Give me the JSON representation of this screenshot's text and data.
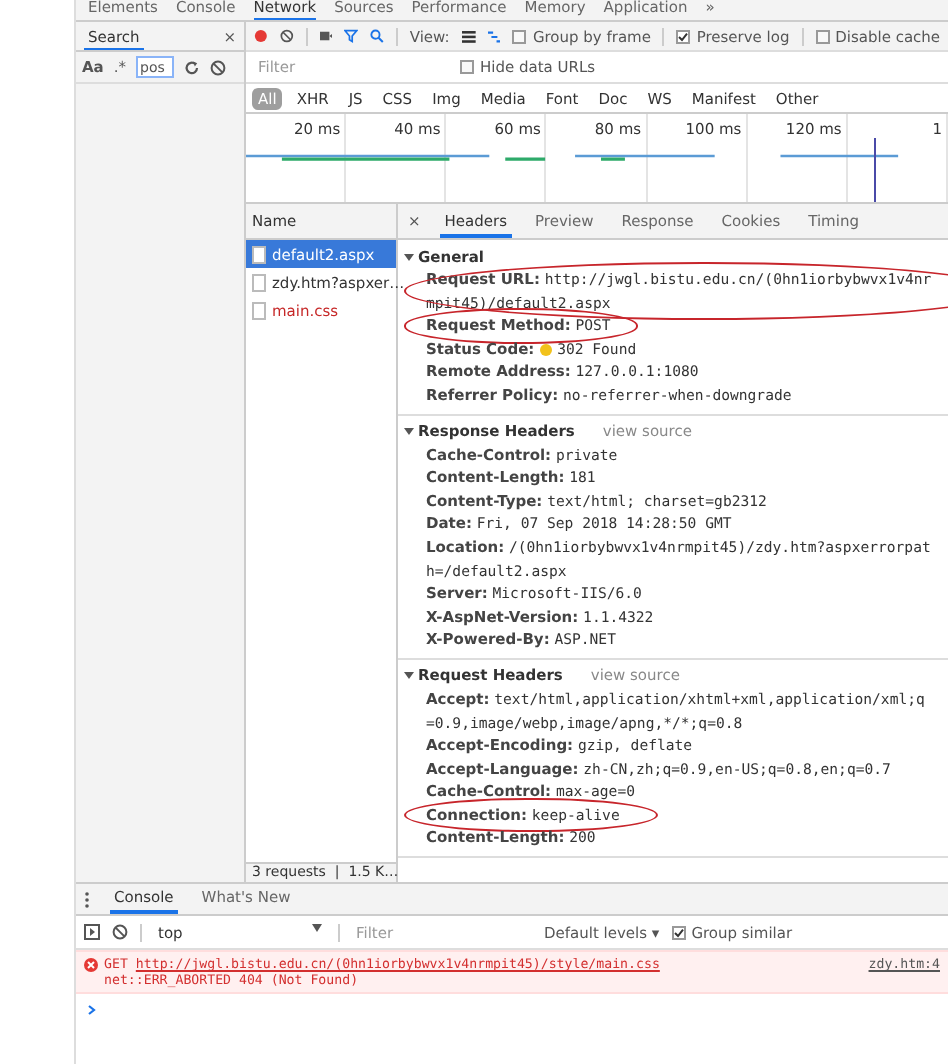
{
  "top_tabs": [
    {
      "label": "Elements",
      "selected": false
    },
    {
      "label": "Console",
      "selected": false
    },
    {
      "label": "Network",
      "selected": true
    },
    {
      "label": "Sources",
      "selected": false
    },
    {
      "label": "Performance",
      "selected": false
    },
    {
      "label": "Memory",
      "selected": false
    },
    {
      "label": "Application",
      "selected": false
    },
    {
      "label": "»",
      "selected": false
    }
  ],
  "search_panel": {
    "title": "Search",
    "close": "×",
    "case_option": "Aa",
    "regex_option": ".*",
    "query": "pos"
  },
  "network_toolbar": {
    "recording": true,
    "view_label": "View:",
    "checkboxes": [
      {
        "label": "Group by frame",
        "checked": false
      },
      {
        "label": "Preserve log",
        "checked": true
      },
      {
        "label": "Disable cache",
        "checked": false
      }
    ]
  },
  "filter": {
    "placeholder": "Filter",
    "hide_data_urls": {
      "label": "Hide data URLs",
      "checked": false
    }
  },
  "type_filters": [
    {
      "label": "All",
      "selected": true
    },
    {
      "label": "XHR",
      "selected": false
    },
    {
      "label": "JS",
      "selected": false
    },
    {
      "label": "CSS",
      "selected": false
    },
    {
      "label": "Img",
      "selected": false
    },
    {
      "label": "Media",
      "selected": false
    },
    {
      "label": "Font",
      "selected": false
    },
    {
      "label": "Doc",
      "selected": false
    },
    {
      "label": "WS",
      "selected": false
    },
    {
      "label": "Manifest",
      "selected": false
    },
    {
      "label": "Other",
      "selected": false
    }
  ],
  "timeline": {
    "ticks": [
      "20 ms",
      "40 ms",
      "60 ms",
      "80 ms",
      "100 ms",
      "120 ms",
      "1"
    ]
  },
  "requests": {
    "header": "Name",
    "items": [
      {
        "name": "default2.aspx",
        "selected": true,
        "failed": false
      },
      {
        "name": "zdy.htm?aspxer…",
        "selected": false,
        "failed": false
      },
      {
        "name": "main.css",
        "selected": false,
        "failed": true
      }
    ],
    "status": "3 requests  |  1.5 K…"
  },
  "detail_tabs": {
    "close": "×",
    "tabs": [
      {
        "label": "Headers",
        "selected": true
      },
      {
        "label": "Preview",
        "selected": false
      },
      {
        "label": "Response",
        "selected": false
      },
      {
        "label": "Cookies",
        "selected": false
      },
      {
        "label": "Timing",
        "selected": false
      }
    ]
  },
  "sections": [
    {
      "title": "General",
      "expanded": true,
      "rows": [
        {
          "kind": "plain",
          "name": "Request URL:",
          "value": "http://jwgl.bistu.edu.cn/(0hn1iorbybwvx1v4nrmpit45)/default2.aspx",
          "circled": true
        },
        {
          "kind": "plain",
          "name": "Request Method:",
          "value": "POST",
          "circled": true
        },
        {
          "kind": "status",
          "name": "Status Code:",
          "value": "302  Found",
          "color": "#f2c21b",
          "circled": false
        },
        {
          "kind": "plain",
          "name": "Remote Address:",
          "value": "127.0.0.1:1080",
          "circled": false
        },
        {
          "kind": "plain",
          "name": "Referrer Policy:",
          "value": "no-referrer-when-downgrade",
          "circled": false
        }
      ]
    },
    {
      "title": "Response Headers",
      "link": "view source",
      "expanded": true,
      "rows": [
        {
          "kind": "plain",
          "name": "Cache-Control:",
          "value": "private",
          "circled": false
        },
        {
          "kind": "plain",
          "name": "Content-Length:",
          "value": "181",
          "circled": false
        },
        {
          "kind": "plain",
          "name": "Content-Type:",
          "value": "text/html; charset=gb2312",
          "circled": false
        },
        {
          "kind": "plain",
          "name": "Date:",
          "value": "Fri, 07 Sep 2018 14:28:50 GMT",
          "circled": false
        },
        {
          "kind": "plain",
          "name": "Location:",
          "value": "/(0hn1iorbybwvx1v4nrmpit45)/zdy.htm?aspxerrorpath=/default2.aspx",
          "circled": false
        },
        {
          "kind": "plain",
          "name": "Server:",
          "value": "Microsoft-IIS/6.0",
          "circled": false
        },
        {
          "kind": "plain",
          "name": "X-AspNet-Version:",
          "value": "1.1.4322",
          "circled": false
        },
        {
          "kind": "plain",
          "name": "X-Powered-By:",
          "value": "ASP.NET",
          "circled": false
        }
      ]
    },
    {
      "title": "Request Headers",
      "link": "view source",
      "expanded": true,
      "rows": [
        {
          "kind": "plain",
          "name": "Accept:",
          "value": "text/html,application/xhtml+xml,application/xml;q=0.9,image/webp,image/apng,*/*;q=0.8",
          "circled": false
        },
        {
          "kind": "plain",
          "name": "Accept-Encoding:",
          "value": "gzip, deflate",
          "circled": false
        },
        {
          "kind": "plain",
          "name": "Accept-Language:",
          "value": "zh-CN,zh;q=0.9,en-US;q=0.8,en;q=0.7",
          "circled": false
        },
        {
          "kind": "plain",
          "name": "Cache-Control:",
          "value": "max-age=0",
          "circled": false
        },
        {
          "kind": "plain",
          "name": "Connection:",
          "value": "keep-alive",
          "circled": true
        },
        {
          "kind": "plain",
          "name": "Content-Length:",
          "value": "200",
          "circled": false
        }
      ]
    }
  ],
  "drawer": {
    "tabs": [
      {
        "label": "Console",
        "selected": true
      },
      {
        "label": "What's New",
        "selected": false
      }
    ],
    "context": "top",
    "filter_placeholder": "Filter",
    "levels": "Default levels ▾",
    "group_similar": {
      "label": "Group similar",
      "checked": true
    },
    "messages": [
      {
        "kind": "error",
        "method": "GET",
        "url": "http://jwgl.bistu.edu.cn/(0hn1iorbybwvx1v4nrmpit45)/style/main.css",
        "detail": "net::ERR_ABORTED 404 (Not Found)",
        "source": "zdy.htm:4"
      }
    ]
  }
}
